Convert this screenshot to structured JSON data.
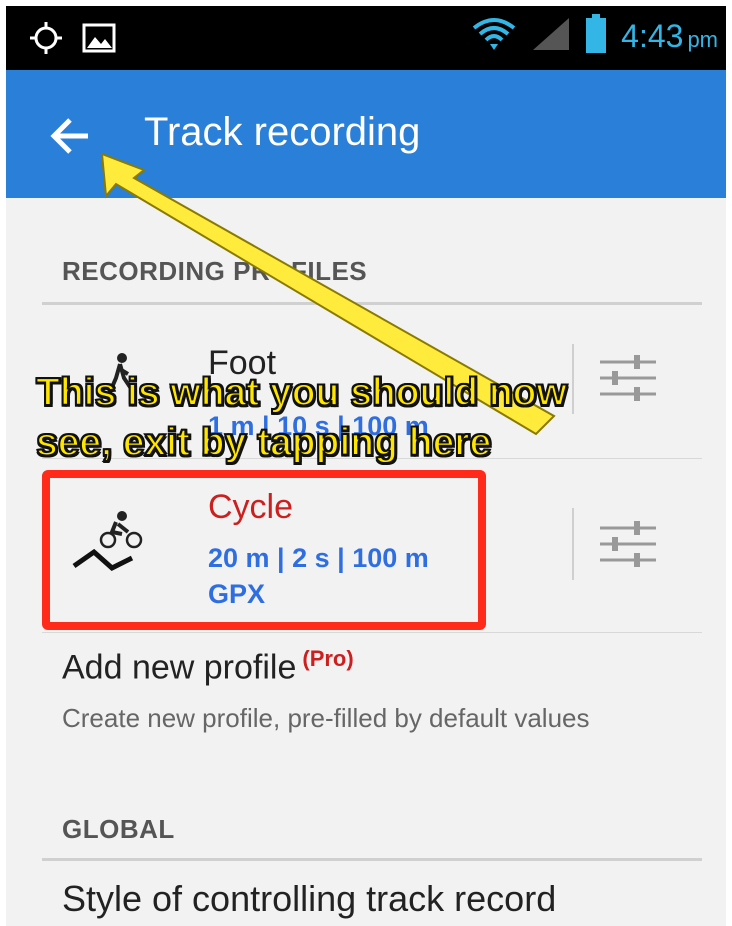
{
  "status_bar": {
    "time": "4:43",
    "ampm": "pm",
    "icons": [
      "gps-icon",
      "image-icon",
      "wifi-icon",
      "signal-icon",
      "battery-icon"
    ]
  },
  "app_bar": {
    "title": "Track recording",
    "back_icon": "arrow-left-icon",
    "color": "#2a7fd9"
  },
  "sections": {
    "profiles_header": "RECORDING PROFILES",
    "global_header": "GLOBAL"
  },
  "profiles": [
    {
      "name": "Foot",
      "meta_line1": "1 m | 10 s | 100 m",
      "icon": "walking-icon"
    },
    {
      "name": "Cycle",
      "meta_line1": "20 m | 2 s | 100 m",
      "meta_line2": "GPX",
      "icon": "cycling-icon",
      "name_color": "#cc1f1f"
    }
  ],
  "add_profile": {
    "title": "Add new profile",
    "badge": "(Pro)",
    "description": "Create new profile, pre-filled by default values"
  },
  "global": {
    "first_item": "Style of controlling track record"
  },
  "annotation": {
    "line1": "This is what you should now",
    "line2": "see, exit by tapping here",
    "highlight_color": "#ff2a1a",
    "text_color": "#ffe600"
  }
}
